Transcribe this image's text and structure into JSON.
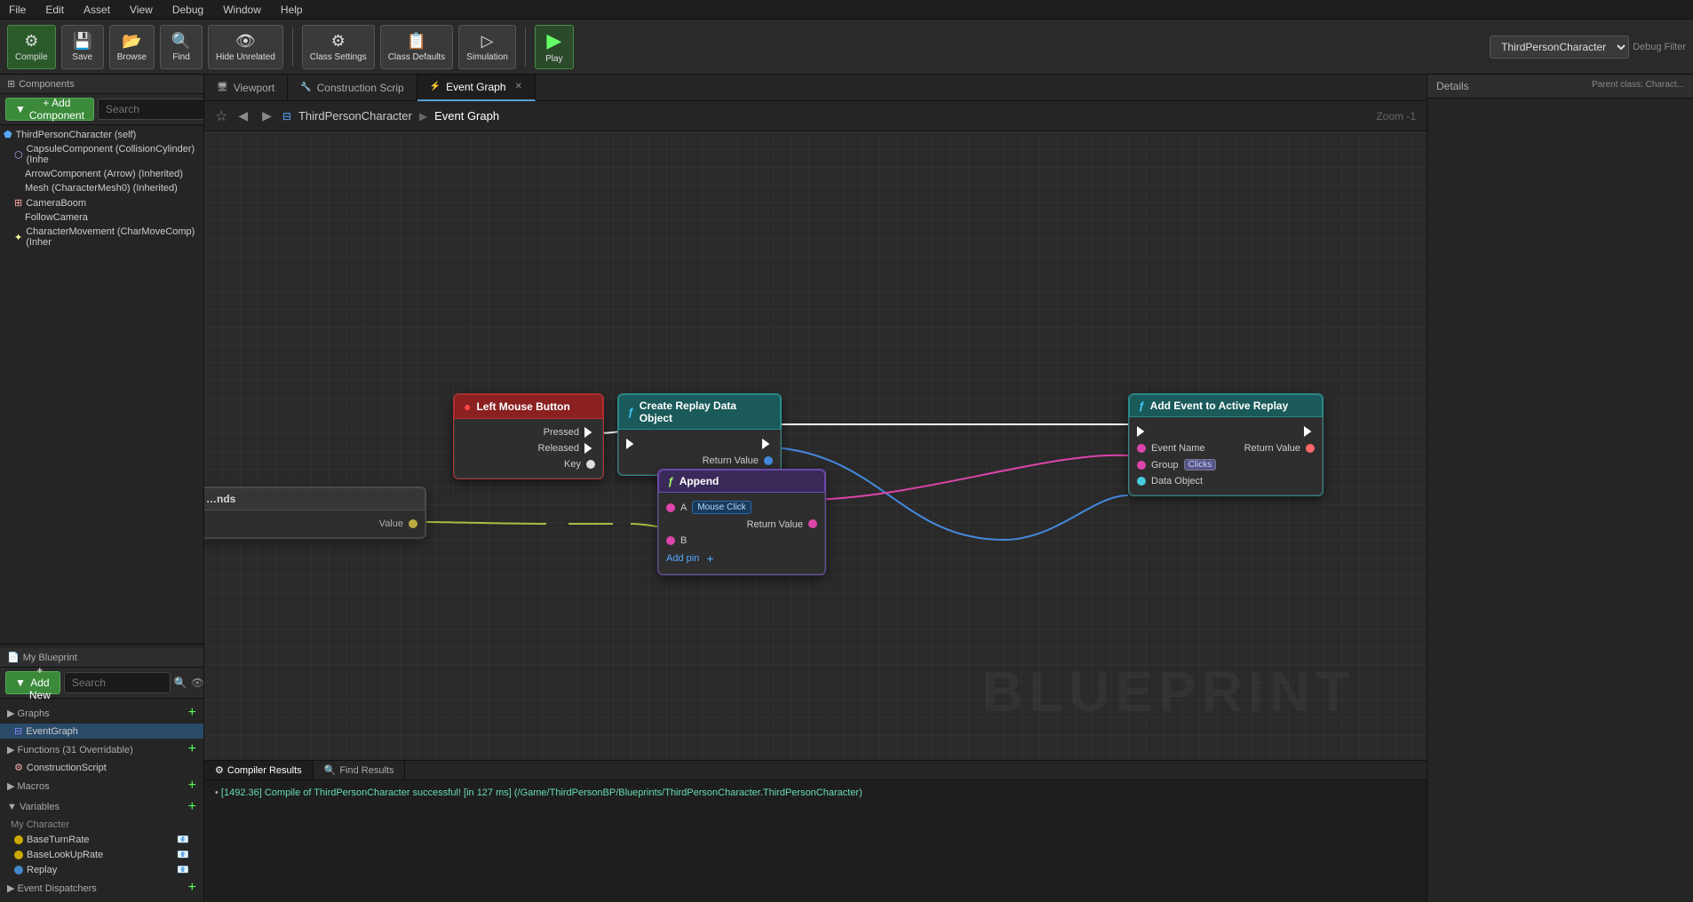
{
  "menu": {
    "items": [
      "File",
      "Edit",
      "Asset",
      "View",
      "Debug",
      "Window",
      "Help"
    ]
  },
  "toolbar": {
    "compile_label": "Compile",
    "save_label": "Save",
    "browse_label": "Browse",
    "find_label": "Find",
    "hide_unrelated_label": "Hide Unrelated",
    "class_settings_label": "Class Settings",
    "class_defaults_label": "Class Defaults",
    "simulation_label": "Simulation",
    "play_label": "Play",
    "search_placeholder": "Search",
    "debug_selector": "ThirdPersonCharacter",
    "debug_filter": "Debug Filter"
  },
  "left_panel": {
    "components_label": "Components",
    "add_component_label": "+ Add Component",
    "search_placeholder": "Search",
    "tree_items": [
      {
        "label": "ThirdPersonCharacter (self)",
        "indent": 0
      },
      {
        "label": "CapsuleComponent (CollisionCylinder) (Inhe",
        "indent": 1,
        "icon": "⬡"
      },
      {
        "label": "ArrowComponent (Arrow) (Inherited)",
        "indent": 2
      },
      {
        "label": "Mesh (CharacterMesh0) (Inherited)",
        "indent": 2
      },
      {
        "label": "CameraBoom",
        "indent": 1,
        "icon": "⊞"
      },
      {
        "label": "FollowCamera",
        "indent": 2
      },
      {
        "label": "CharacterMovement (CharMoveComp) (Inher",
        "indent": 1,
        "icon": "✦"
      }
    ]
  },
  "my_blueprint": {
    "label": "My Blueprint",
    "add_new_label": "+ Add New",
    "search_placeholder": "Search",
    "sections": {
      "graphs": {
        "label": "Graphs",
        "items": [
          "EventGraph"
        ]
      },
      "functions": {
        "label": "Functions (31 Overridable)",
        "items": [
          "ConstructionScript"
        ]
      },
      "macros": {
        "label": "Macros",
        "items": []
      },
      "variables": {
        "label": "Variables",
        "group": "My Character",
        "items": [
          {
            "label": "BaseTurnRate",
            "color": "yellow"
          },
          {
            "label": "BaseLookUpRate",
            "color": "yellow"
          },
          {
            "label": "Replay",
            "color": "blue"
          }
        ]
      },
      "event_dispatchers": {
        "label": "Event Dispatchers",
        "items": []
      }
    }
  },
  "tabs": {
    "viewport": "Viewport",
    "construction": "Construction Scrip",
    "event_graph": "Event Graph"
  },
  "breadcrumb": {
    "class": "ThirdPersonCharacter",
    "graph": "Event Graph",
    "zoom_label": "Zoom -1"
  },
  "nodes": {
    "left_mouse_button": {
      "title": "Left Mouse Button",
      "pins": [
        "Pressed",
        "Released",
        "Key"
      ]
    },
    "create_replay": {
      "title": "Create Replay Data Object",
      "pins_in": [],
      "pins_out": [
        "Return Value"
      ]
    },
    "add_event": {
      "title": "Add Event to Active Replay",
      "pins_in": [
        "Event Name",
        "Group",
        "Data Object"
      ],
      "pins_out": [
        "Return Value"
      ],
      "group_value": "Clicks"
    },
    "append": {
      "title": "Append",
      "pins": [
        "A",
        "B"
      ],
      "pin_a_value": "Mouse Click",
      "pins_out": [
        "Return Value"
      ]
    }
  },
  "bottom_panel": {
    "tabs": [
      "Compiler Results",
      "Find Results"
    ],
    "log": "[1492.36] Compile of ThirdPersonCharacter successful! [in 127 ms] (/Game/ThirdPersonBP/Blueprints/ThirdPersonCharacter.ThirdPersonCharacter)"
  },
  "right_panel": {
    "title": "Details",
    "parent_class": "Parent class: Charact..."
  },
  "watermark": "BLUEPRINT"
}
